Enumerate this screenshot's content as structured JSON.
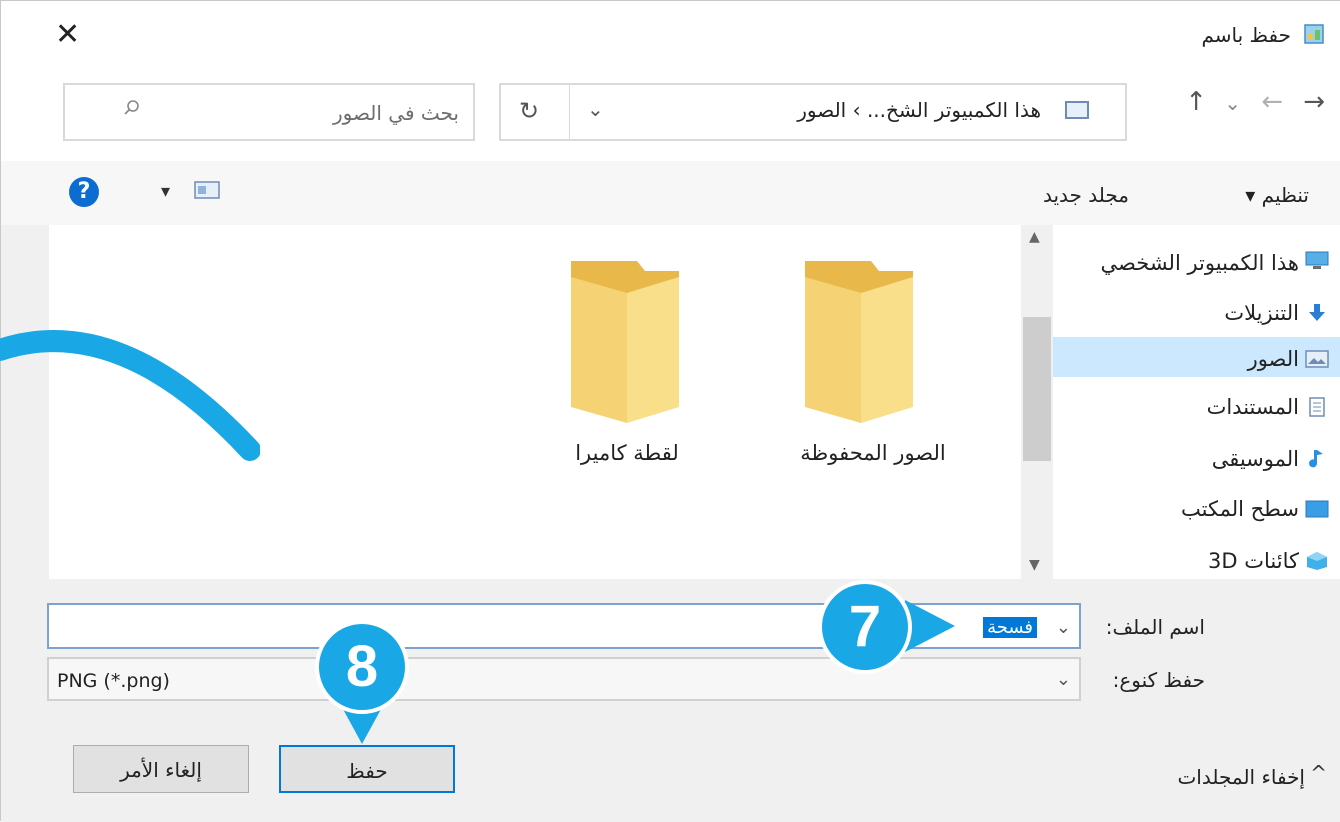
{
  "window": {
    "title": "حفظ باسم",
    "close_glyph": "✕"
  },
  "nav": {
    "back_glyph": "→",
    "forward_glyph": "←",
    "recent_glyph": "⌄",
    "up_glyph": "↑",
    "address_path": "هذا الكمبيوتر الشخ... › الصور",
    "refresh_glyph": "↻",
    "dropdown_glyph": "⌄"
  },
  "search": {
    "placeholder": "بحث في الصور"
  },
  "toolbar": {
    "organize_label": "تنظيم ▾",
    "new_folder_label": "مجلد جديد",
    "view_dropdown_glyph": "▾",
    "help_glyph": "?"
  },
  "sidebar": {
    "items": [
      {
        "label": "هذا الكمبيوتر الشخصي",
        "icon": "computer-icon"
      },
      {
        "label": "التنزيلات",
        "icon": "download-icon"
      },
      {
        "label": "الصور",
        "icon": "pictures-icon"
      },
      {
        "label": "المستندات",
        "icon": "documents-icon"
      },
      {
        "label": "الموسيقى",
        "icon": "music-icon"
      },
      {
        "label": "سطح المكتب",
        "icon": "desktop-icon"
      },
      {
        "label": "كائنات 3D",
        "icon": "3d-objects-icon"
      }
    ],
    "selected_index": 2
  },
  "content": {
    "folders": [
      {
        "name": "الصور المحفوظة"
      },
      {
        "name": "لقطة كاميرا"
      }
    ]
  },
  "form": {
    "filename_label": "اسم الملف:",
    "filename_value": "فسحة",
    "filetype_label": "حفظ كنوع:",
    "filetype_value": "PNG (*.png)",
    "dropdown_glyph": "⌄"
  },
  "footer": {
    "hide_folders_label": "إخفاء المجلدات",
    "hide_chevron": "^",
    "save_label": "حفظ",
    "cancel_label": "إلغاء الأمر"
  },
  "callouts": {
    "step7": "7",
    "step8": "8"
  },
  "colors": {
    "accent": "#0078d7",
    "callout": "#1aa7e6",
    "selection": "#cce8ff",
    "folder": "#f5d274"
  }
}
